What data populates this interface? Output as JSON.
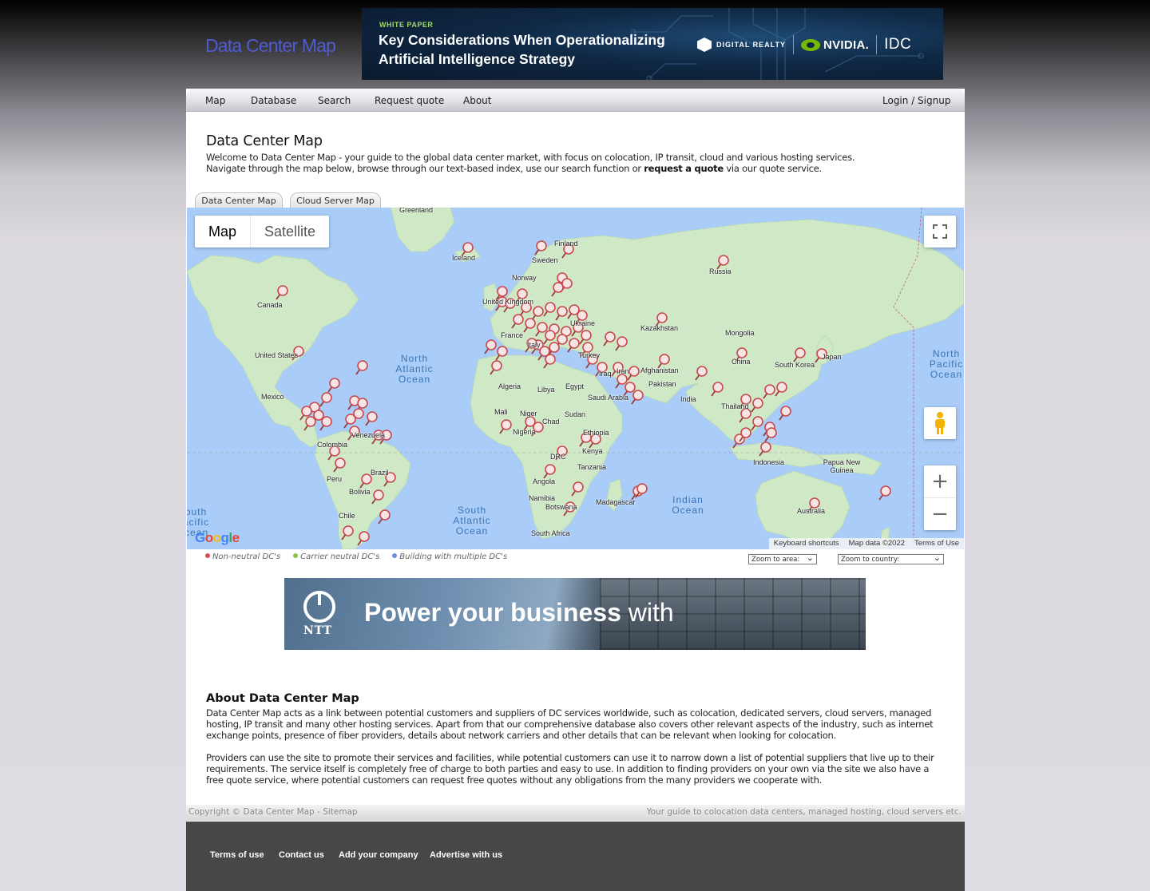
{
  "site": {
    "logo": "Data Center Map"
  },
  "top_ad": {
    "kicker": "WHITE PAPER",
    "headline": "Key Considerations When Operationalizing Artificial Intelligence Strategy",
    "logos": [
      "DIGITAL REALTY",
      "NVIDIA.",
      "IDC"
    ]
  },
  "nav": {
    "items": [
      "Map",
      "Database",
      "Search",
      "Request quote",
      "About"
    ],
    "login": "Login / Signup"
  },
  "intro": {
    "title": "Data Center Map",
    "line1": "Welcome to Data Center Map - your guide to the global data center market, with focus on colocation, IP transit, cloud and various hosting services.",
    "line2_pre": "Navigate through the map below, browse through our text-based index, use our search function or ",
    "line2_link": "request a quote",
    "line2_post": " via our quote service."
  },
  "tabs": [
    "Data Center Map",
    "Cloud Server Map"
  ],
  "map": {
    "type_active": "Map",
    "type_inactive": "Satellite",
    "countries": [
      "Greenland",
      "Iceland",
      "Finland",
      "Sweden",
      "Norway",
      "Russia",
      "Canada",
      "United Kingdom",
      "Ukraine",
      "Kazakhstan",
      "Mongolia",
      "France",
      "Italy",
      "United States",
      "Turkey",
      "Iran",
      "Afghanistan",
      "China",
      "Japan",
      "South Korea",
      "Pakistan",
      "India",
      "Algeria",
      "Libya",
      "Egypt",
      "Saudi Arabia",
      "Iraq",
      "Mexico",
      "Mali",
      "Niger",
      "Chad",
      "Sudan",
      "Thailand",
      "Venezuela",
      "Colombia",
      "Nigeria",
      "Ethiopia",
      "Kenya",
      "DRC",
      "Tanzania",
      "Indonesia",
      "Papua New Guinea",
      "Brazil",
      "Peru",
      "Bolivia",
      "Angola",
      "Namibia",
      "Botswana",
      "Madagascar",
      "Chile",
      "South Africa",
      "Australia"
    ],
    "oceans": [
      "North Atlantic Ocean",
      "North Pacific Ocean",
      "South Atlantic Ocean",
      "Indian Ocean",
      "South Pacific Ocean"
    ],
    "attribution": [
      "Keyboard shortcuts",
      "Map data ©2022",
      "Terms of Use"
    ],
    "google": "Google"
  },
  "legend": [
    "Non-neutral DC's",
    "Carrier neutral DC's",
    "Building with multiple DC's"
  ],
  "legend_colors": [
    "#d9534f",
    "#8bc34a",
    "#6f8fd6"
  ],
  "selects": {
    "area": "Zoom to area:",
    "country": "Zoom to country:"
  },
  "ntt_ad": {
    "brand": "NTT",
    "message_bold": "Power your business",
    "message_rest": " with"
  },
  "about": {
    "title": "About Data Center Map",
    "p1": "Data Center Map acts as a link between potential customers and suppliers of DC services worldwide, such as colocation, dedicated servers, cloud servers, managed hosting, IP transit and many other hosting services. Apart from that our comprehensive database also covers other relevant aspects of the industry, such as internet exchange points, presence of fiber providers, details about network carriers and other details that can be relevant when looking for colocation.",
    "p2": "Providers can use the site to promote their services and facilities, while potential customers can use it to narrow down a list of potential suppliers that live up to their requirements. The service itself is completely free of charge to both parties and easy to use. In addition to finding providers on your own via the site we also have a free quote service, where potential customers can request free quotes without any obligations from the many providers we cooperate with."
  },
  "copyright": {
    "left": "Copyright © Data Center Map - Sitemap",
    "right": "Your guide to colocation data centers, managed hosting, cloud servers etc."
  },
  "footer": [
    "Terms of use",
    "Contact us",
    "Add your company",
    "Advertise with us"
  ],
  "colors": {
    "land": "#cfe9c7",
    "ocean": "#a9cdf8",
    "logo": "#4f5bd0",
    "marker": "#d9534f"
  }
}
